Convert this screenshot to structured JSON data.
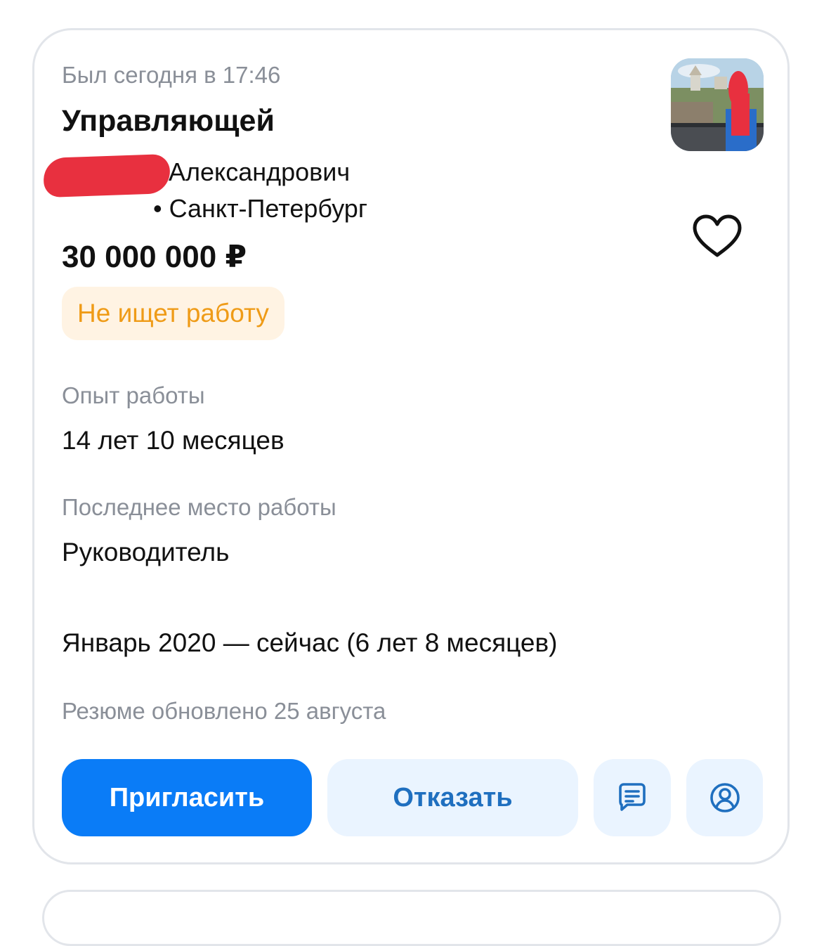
{
  "card": {
    "last_seen": "Был сегодня в 17:46",
    "title": "Управляющей",
    "name_visible": "Александрович",
    "location": "• Санкт-Петербург",
    "salary": "30 000 000 ₽",
    "status_badge": "Не ищет работу",
    "experience_label": "Опыт работы",
    "experience_value": "14 лет 10 месяцев",
    "last_job_label": "Последнее место работы",
    "last_job_position": "Руководитель",
    "last_job_period": "Январь 2020 — сейчас (6 лет 8 месяцев)",
    "resume_updated": "Резюме обновлено 25 августа"
  },
  "actions": {
    "invite_label": "Пригласить",
    "reject_label": "Отказать"
  },
  "icons": {
    "favorite": "heart-icon",
    "chat": "chat-icon",
    "profile": "profile-icon"
  },
  "colors": {
    "primary": "#0a7cf7",
    "secondary_bg": "#eaf4ff",
    "secondary_text": "#1f6fbf",
    "status_bg": "#fff3e3",
    "status_text": "#ef9b17",
    "redaction": "#e8303f"
  }
}
